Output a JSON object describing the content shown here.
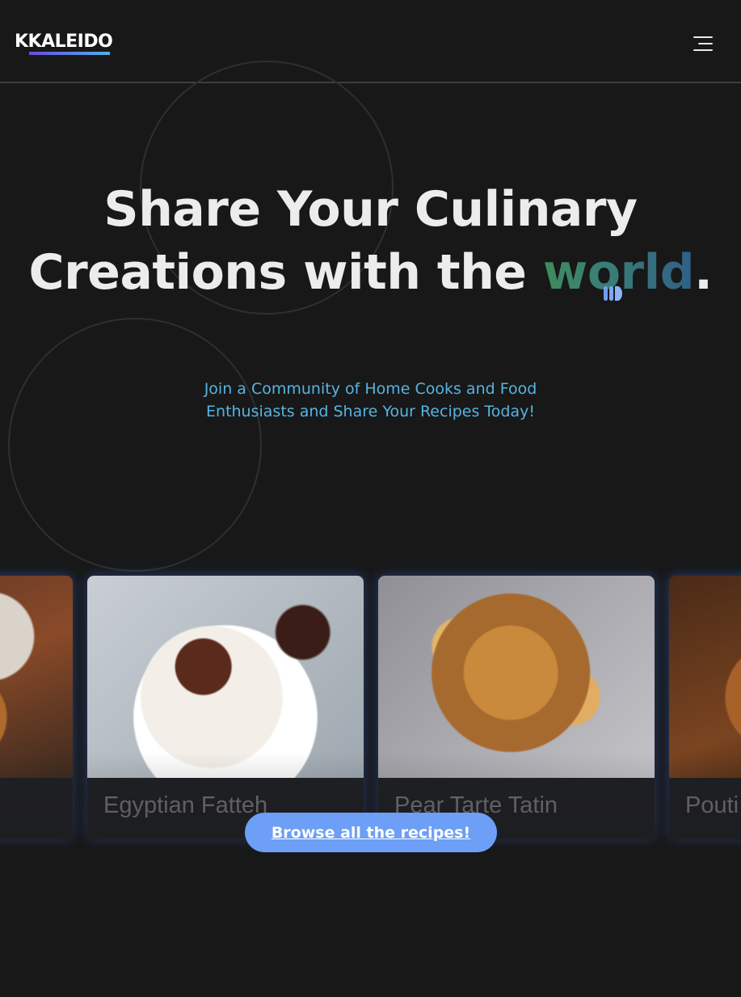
{
  "header": {
    "logo_text": "KKALEIDO",
    "menu_icon": "hamburger-menu-icon"
  },
  "hero": {
    "title_line1": "Share Your Culinary",
    "title_line2_prefix": "Creations with the ",
    "title_highlight": "world",
    "title_period": ".",
    "subtitle": "Join a Community of Home Cooks and Food Enthusiasts and Share Your Recipes Today!"
  },
  "recipes": [
    {
      "title": ""
    },
    {
      "title": "Egyptian Fatteh"
    },
    {
      "title": "Pear Tarte Tatin"
    },
    {
      "title": "Pouti"
    }
  ],
  "cta": {
    "label": "Browse all the recipes!"
  },
  "colors": {
    "background": "#181819",
    "accent_blue": "#6c9ff5",
    "subtitle_blue": "#56b4e0",
    "highlight_green": "#3f8c5e"
  }
}
